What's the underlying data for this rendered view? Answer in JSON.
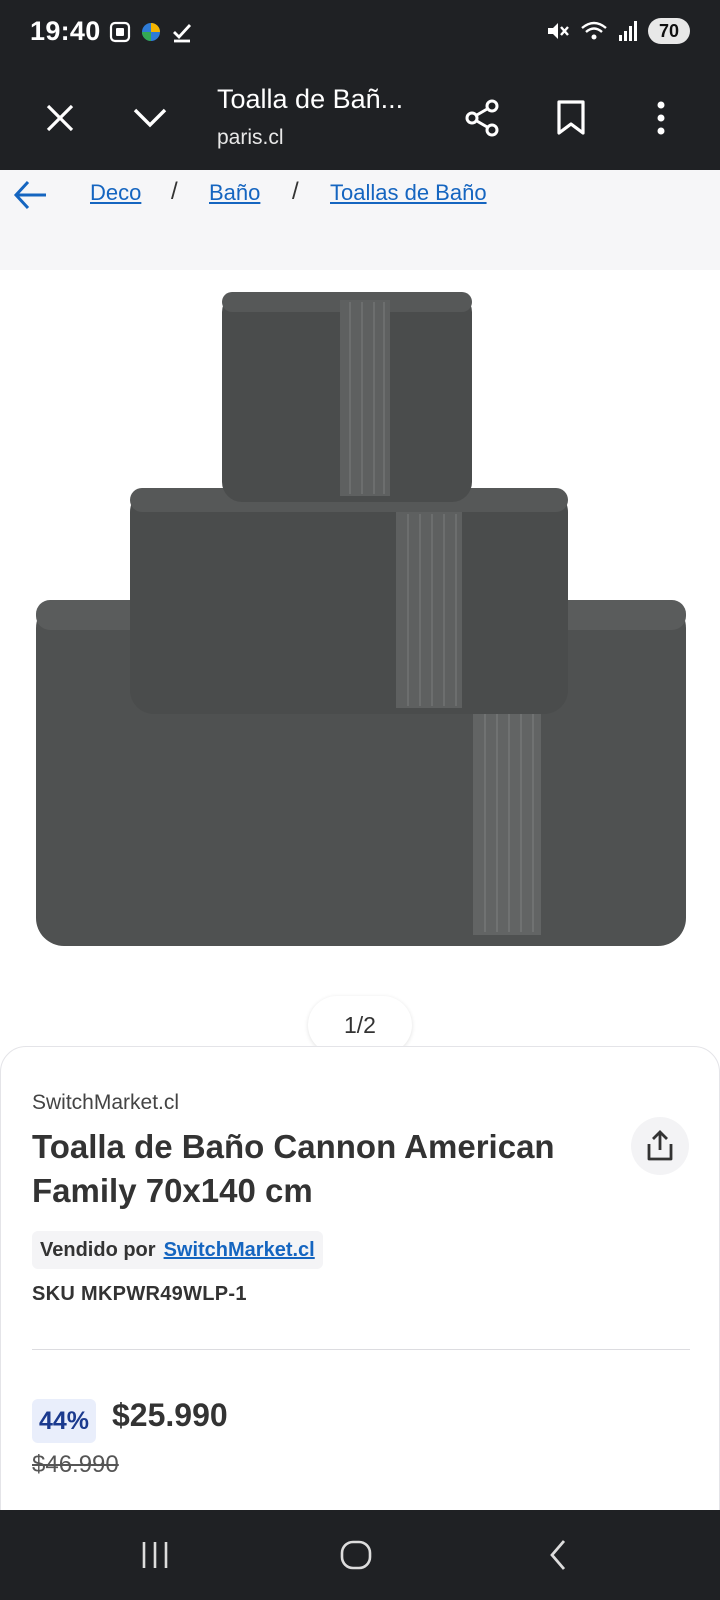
{
  "status_bar": {
    "time": "19:40",
    "battery": "70",
    "icons": [
      "screenshot-icon",
      "app-icon",
      "check-icon",
      "mute-icon",
      "wifi-icon",
      "signal-icon"
    ]
  },
  "browser": {
    "title": "Toalla de Bañ...",
    "domain": "paris.cl"
  },
  "breadcrumb": {
    "items": [
      "Deco",
      "Baño",
      "Toallas de Baño"
    ],
    "separator": "/"
  },
  "gallery": {
    "counter": "1/2"
  },
  "product": {
    "seller": "SwitchMarket.cl",
    "title": "Toalla de Baño Cannon American Family 70x140 cm",
    "sold_by_label": "Vendido por",
    "sold_by_link": "SwitchMarket.cl",
    "sku": "SKU MKPWR49WLP-1",
    "discount": "44%",
    "price": "$25.990",
    "old_price": "$46.990"
  },
  "colors": {
    "link": "#1565c0",
    "discount_text": "#1b3a8e",
    "discount_bg": "#e9eefb",
    "bar_bg": "#1f2124",
    "towel": "#4f5151"
  }
}
